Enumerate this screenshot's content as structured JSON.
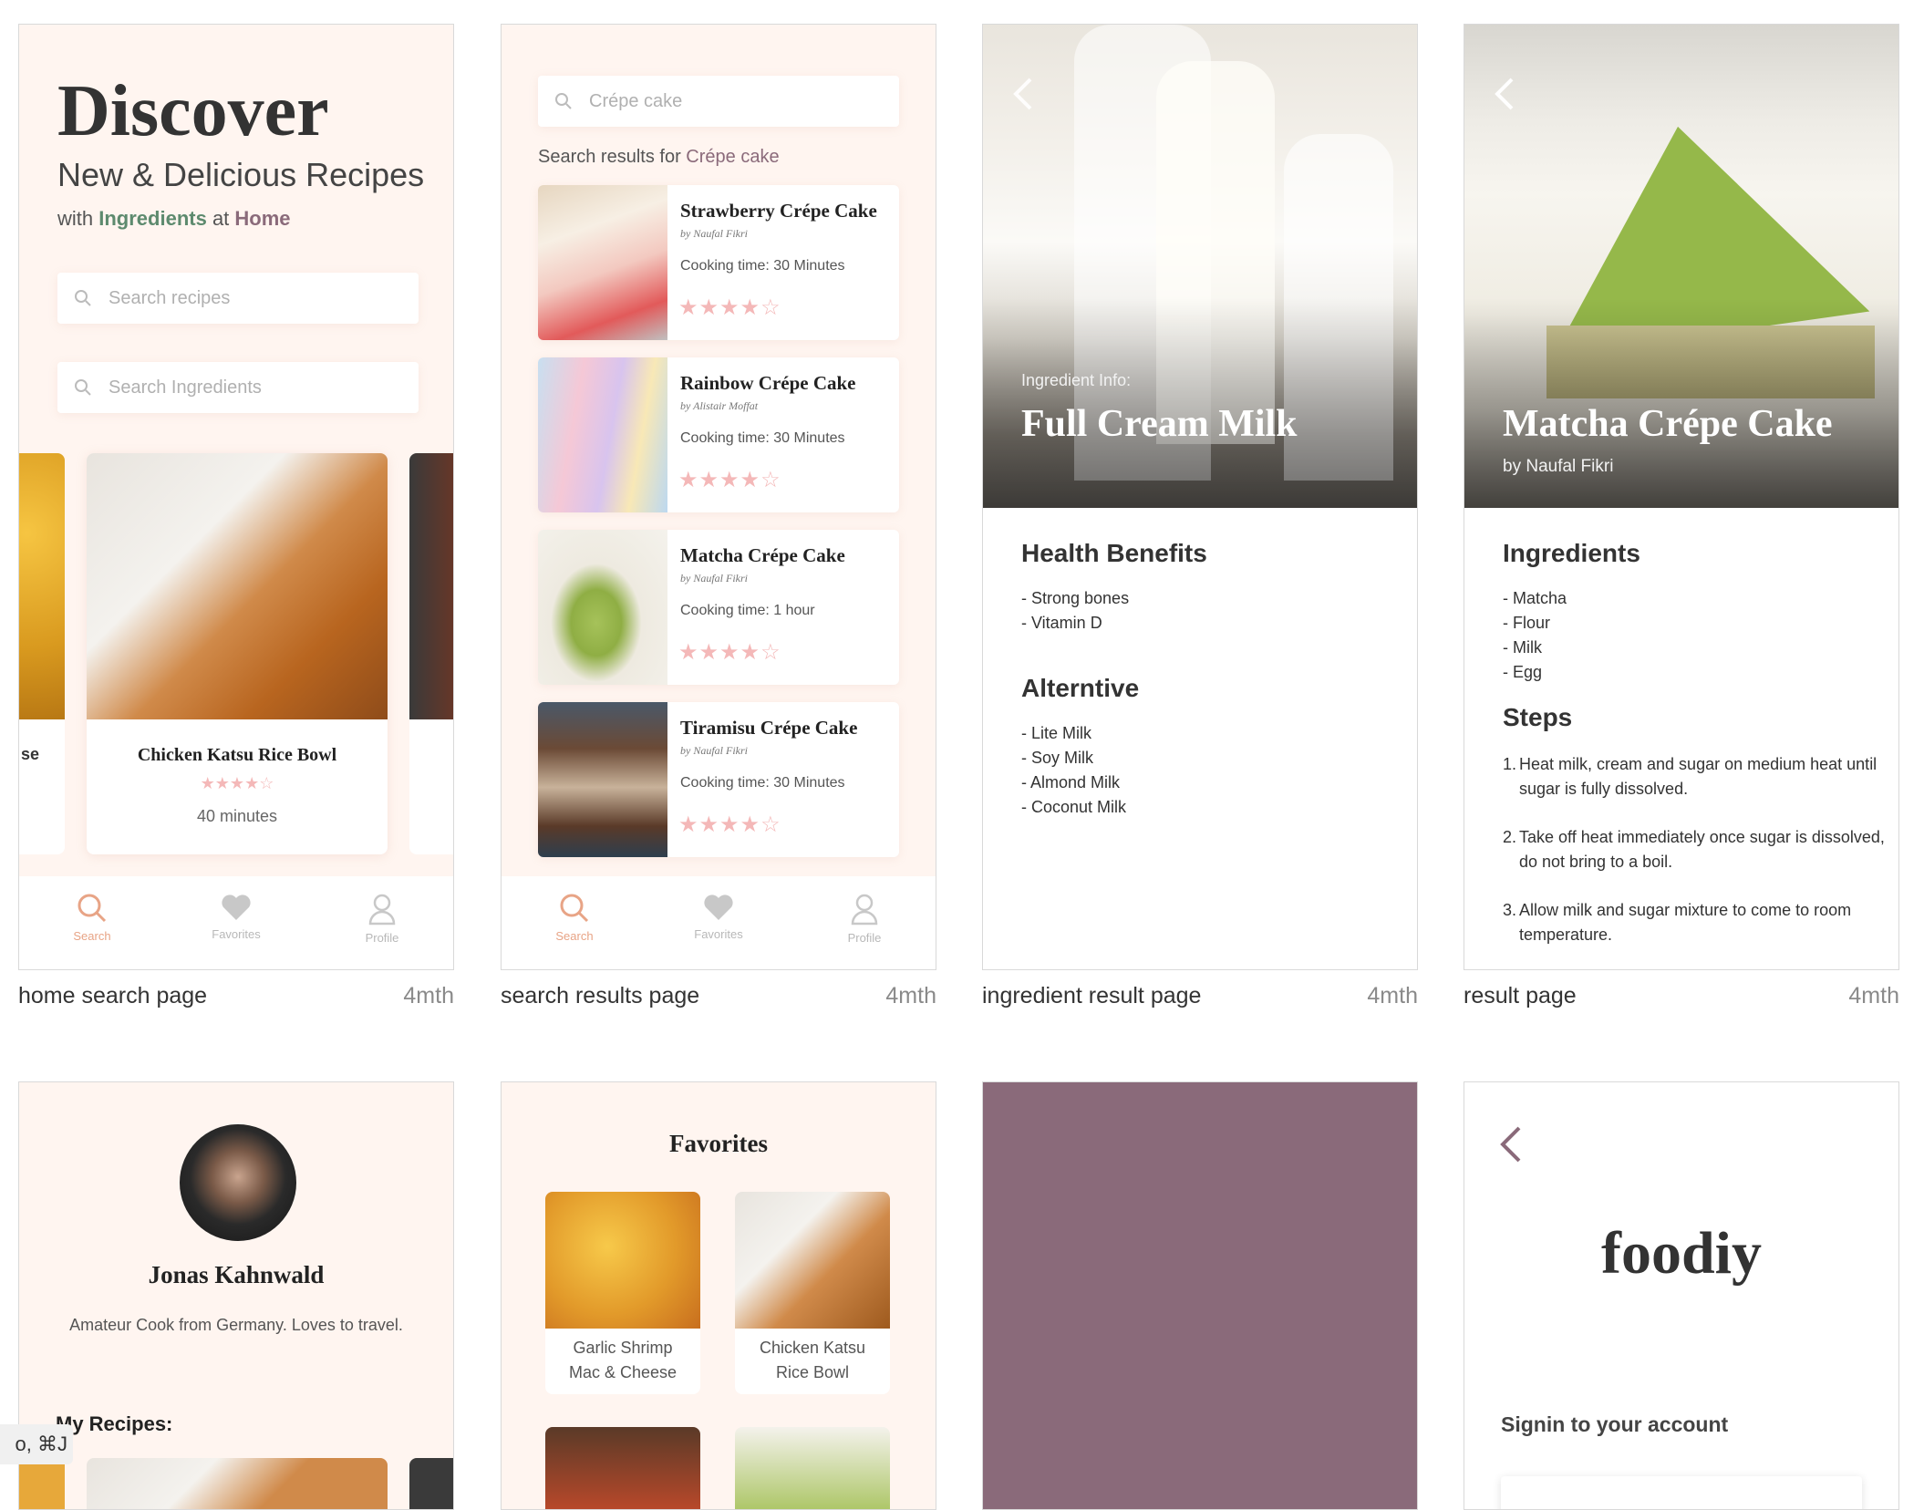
{
  "cards": {
    "home": {
      "title": "Discover",
      "subtitle": "New & Delicious Recipes",
      "tagline_pre": "with ",
      "tagline_ingredients": "Ingredients",
      "tagline_mid": " at ",
      "tagline_home": "Home",
      "search_recipes_placeholder": "Search recipes",
      "search_ingredients_placeholder": "Search Ingredients",
      "left_partial_label": "se",
      "feature": {
        "name": "Chicken Katsu Rice Bowl",
        "rating": "★★★★☆",
        "time": "40 minutes"
      },
      "caption": "home search page",
      "caption_meta": "4mth"
    },
    "results": {
      "search_value": "Crépe cake",
      "results_label_pre": "Search results for ",
      "results_query": "Crépe cake",
      "items": [
        {
          "title": "Strawberry Crépe Cake",
          "by": "by Naufal Fikri",
          "time": "Cooking time: 30 Minutes",
          "rating": "★★★★☆"
        },
        {
          "title": "Rainbow Crépe Cake",
          "by": "by Alistair Moffat",
          "time": "Cooking time: 30 Minutes",
          "rating": "★★★★☆"
        },
        {
          "title": "Matcha Crépe Cake",
          "by": "by Naufal Fikri",
          "time": "Cooking time: 1 hour",
          "rating": "★★★★☆"
        },
        {
          "title": "Tiramisu Crépe Cake",
          "by": "by Naufal Fikri",
          "time": "Cooking time: 30 Minutes",
          "rating": "★★★★☆"
        }
      ],
      "caption": "search results page",
      "caption_meta": "4mth"
    },
    "ingredient": {
      "label": "Ingredient Info:",
      "title": "Full Cream Milk",
      "benefits_heading": "Health Benefits",
      "benefits": [
        "- Strong bones",
        "- Vitamin D"
      ],
      "alt_heading": "Alterntive",
      "alternatives": [
        "- Lite Milk",
        "- Soy Milk",
        "- Almond Milk",
        "- Coconut Milk"
      ],
      "caption": "ingredient result page",
      "caption_meta": "4mth"
    },
    "result": {
      "title": "Matcha Crépe Cake",
      "author": "by Naufal Fikri",
      "ingredients_heading": "Ingredients",
      "ingredients": [
        "-  Matcha",
        "-  Flour",
        "-  Milk",
        "-  Egg"
      ],
      "steps_heading": "Steps",
      "steps": [
        {
          "n": "1.",
          "text": "Heat milk, cream and sugar on medium heat until sugar is fully dissolved."
        },
        {
          "n": "2.",
          "text": "Take off heat immediately once sugar is dissolved, do not bring to a boil."
        },
        {
          "n": "3.",
          "text": "Allow milk and sugar mixture to come to room temperature."
        }
      ],
      "caption": "result page",
      "caption_meta": "4mth"
    },
    "profile": {
      "name": "Jonas Kahnwald",
      "bio": "Amateur Cook from Germany. Loves to travel.",
      "recipes_heading": "My Recipes:"
    },
    "favorites": {
      "title": "Favorites",
      "items": [
        "Garlic Shrimp Mac & Cheese",
        "Chicken Katsu Rice Bowl"
      ]
    },
    "login": {
      "logo": "foodiy",
      "subtitle": "Signin to your account"
    }
  },
  "nav": {
    "search": "Search",
    "favorites": "Favorites",
    "profile": "Profile"
  },
  "shortcut_hint": "o, ⌘J",
  "colors": {
    "accent": "#e8a486",
    "ingredient_green": "#5d8a6e",
    "brand_purple": "#8a6a7a",
    "card_bg": "#fff5f0"
  }
}
